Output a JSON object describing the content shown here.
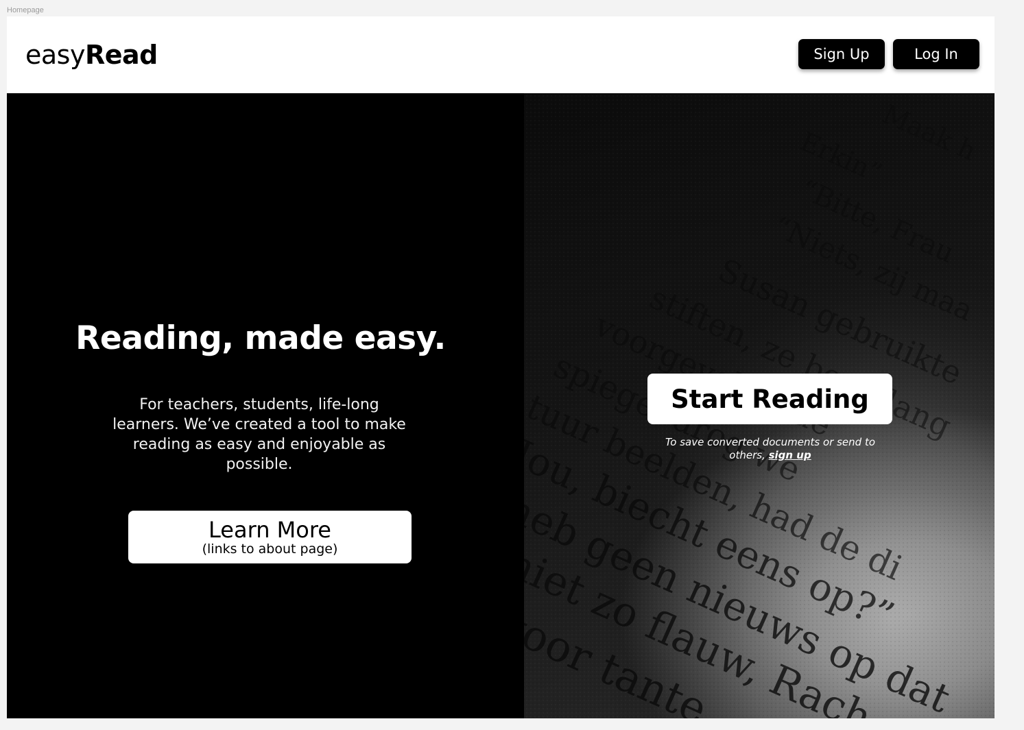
{
  "frame_label": "Homepage",
  "header": {
    "logo_light": "easy",
    "logo_bold": "Read",
    "signup_label": "Sign Up",
    "login_label": "Log In"
  },
  "hero_left": {
    "headline": "Reading, made easy.",
    "subtext": "For teachers, students, life-long learners. We’ve created a tool to make reading as easy and enjoyable as possible.",
    "learn_more_label": "Learn More",
    "learn_more_note": "(links to about page)"
  },
  "hero_right": {
    "start_reading_label": "Start Reading",
    "note_prefix": "To save converted documents or send to others, ",
    "note_link": "sign up",
    "background_text_lines": [
      "Maak h",
      "Erkin”",
      "“Bitte, Frau",
      "“Niets, zij maa",
      "Susan gebruikte",
      "stiften, ze boog lang",
      "voorgevel op de",
      "spiegel drog we",
      "tuur beelden, had de di",
      "Jou, biecht eens op?”",
      "heb geen nieuws op dat",
      "niet zo flauw, Rach",
      "voor tante"
    ]
  },
  "colors": {
    "page_bg": "#f3f3f3",
    "frame_bg": "#ffffff",
    "hero_left_bg": "#000000",
    "button_dark": "#000000",
    "button_light": "#ffffff"
  }
}
